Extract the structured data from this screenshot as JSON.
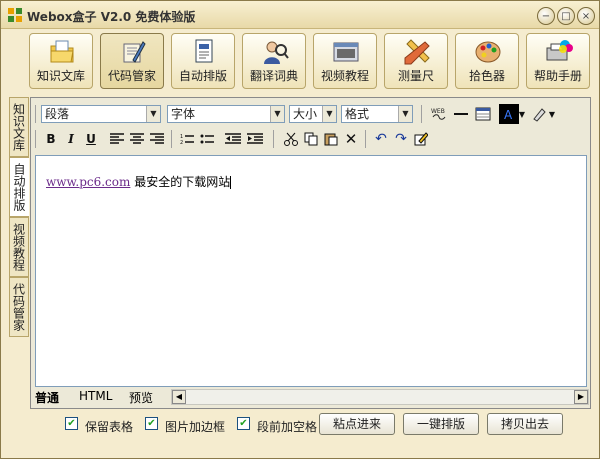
{
  "window": {
    "title": "Webox盒子 V2.0 免费体验版",
    "controls": [
      "minimize-icon",
      "maximize-icon",
      "close-icon"
    ]
  },
  "main_toolbar": [
    {
      "label": "知识文库",
      "icon": "document-folder-icon"
    },
    {
      "label": "代码管家",
      "icon": "code-scroll-icon"
    },
    {
      "label": "自动排版",
      "icon": "text-document-icon"
    },
    {
      "label": "翻译词典",
      "icon": "translator-person-icon"
    },
    {
      "label": "视频教程",
      "icon": "video-window-icon"
    },
    {
      "label": "测量尺",
      "icon": "ruler-pencil-icon"
    },
    {
      "label": "拾色器",
      "icon": "palette-icon"
    },
    {
      "label": "帮助手册",
      "icon": "color-printer-icon"
    }
  ],
  "side_tabs": [
    {
      "label": "知识文库"
    },
    {
      "label": "自动排版"
    },
    {
      "label": "视频教程"
    },
    {
      "label": "代码管家"
    }
  ],
  "format_bar": {
    "paragraph_select": "段落",
    "font_select": "字体",
    "size_select": "大小",
    "style_select": "格式"
  },
  "editor": {
    "link_text": "www.pc6.com",
    "text_after_link": " 最安全的下载网站"
  },
  "mode_tabs": [
    "普通",
    "HTML",
    "预览"
  ],
  "options": {
    "keep_table": "保留表格",
    "image_border": "图片加边框",
    "indent_space": "段前加空格"
  },
  "actions": {
    "paste_in": "粘点进来",
    "one_click_layout": "一键排版",
    "copy_out": "拷贝出去"
  }
}
